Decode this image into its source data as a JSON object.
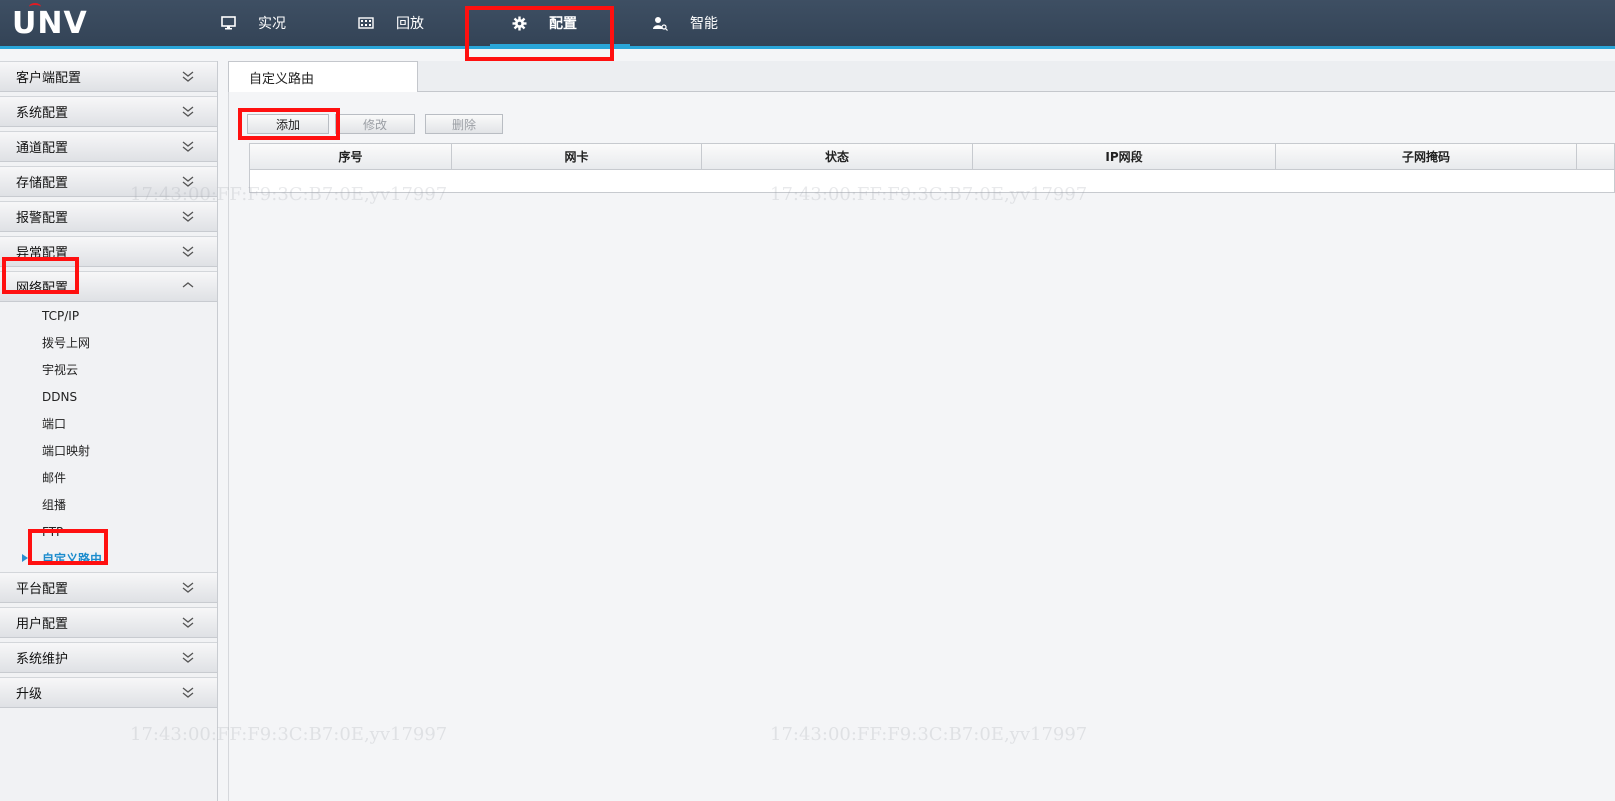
{
  "brand": {
    "logo_text": "UNV",
    "accent": "#2aa6d9",
    "highlight": "#ff1010"
  },
  "topnav": [
    {
      "label": "实况",
      "icon": "monitor-icon"
    },
    {
      "label": "回放",
      "icon": "film-icon"
    },
    {
      "label": "配置",
      "icon": "gear-icon",
      "active": true
    },
    {
      "label": "智能",
      "icon": "person-search-icon"
    }
  ],
  "sidebar": {
    "sections_top": [
      "客户端配置",
      "系统配置",
      "通道配置",
      "存储配置",
      "报警配置",
      "异常配置"
    ],
    "expanded": {
      "label": "网络配置",
      "items": [
        "TCP/IP",
        "拨号上网",
        "宇视云",
        "DDNS",
        "端口",
        "端口映射",
        "邮件",
        "组播",
        "FTP",
        "自定义路由"
      ],
      "active": "自定义路由"
    },
    "sections_bottom": [
      "平台配置",
      "用户配置",
      "系统维护",
      "升级"
    ]
  },
  "main": {
    "tab": "自定义路由",
    "buttons": {
      "add": "添加",
      "edit": "修改",
      "delete": "删除"
    },
    "table_headers": [
      "序号",
      "网卡",
      "状态",
      "IP网段",
      "子网掩码"
    ]
  },
  "watermark": "17:43:00:FF:F9:3C:B7:0E,yv17997"
}
